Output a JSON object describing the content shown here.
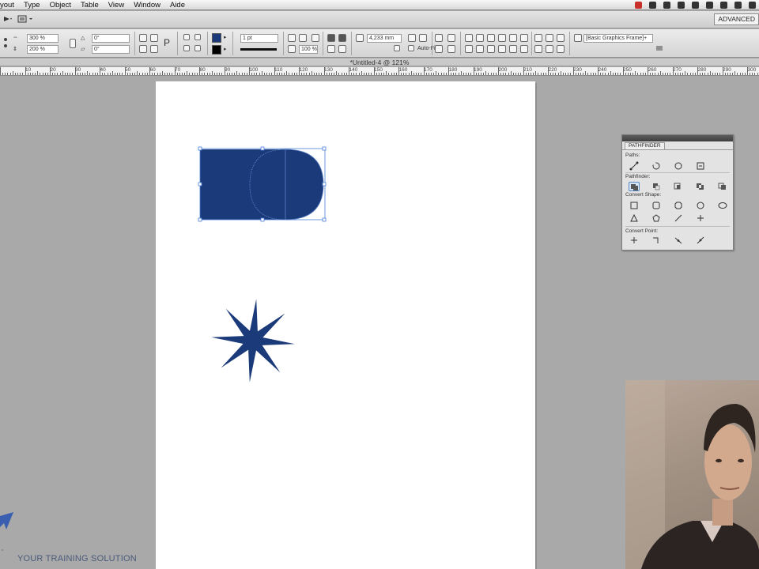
{
  "menubar": {
    "items": [
      "yout",
      "Type",
      "Object",
      "Table",
      "View",
      "Window",
      "Aide"
    ]
  },
  "appbar": {
    "workspace_label": "ADVANCED"
  },
  "control": {
    "x_value": "300 %",
    "y_value": "200 %",
    "w_value": "0°",
    "h_value": "0°",
    "stroke_value": "1 pt",
    "opacity_value": "100 %",
    "size_value": "4,233 mm",
    "autofit_label": "Auto-Fit",
    "style_value": "[Basic Graphics Frame]+",
    "fill_color": "#1b3a7a",
    "stroke_color": "#000000"
  },
  "document": {
    "tab_title": "*Untitled-4 @ 121%"
  },
  "ruler": {
    "labels": [
      "10",
      "20",
      "30",
      "40",
      "50",
      "60",
      "70",
      "80",
      "90",
      "100",
      "110",
      "120",
      "130",
      "140",
      "150",
      "160",
      "170",
      "180",
      "190",
      "200",
      "210",
      "220",
      "230",
      "240",
      "250",
      "260",
      "270",
      "280",
      "290",
      "300"
    ]
  },
  "canvas": {
    "shape_color": "#1b3a7a",
    "selection_color": "#4a7fd4"
  },
  "pathfinder": {
    "tab_label": "PATHFINDER",
    "sections": {
      "paths": "Paths:",
      "pathfinder": "Pathfinder:",
      "convert_shape": "Convert Shape:",
      "convert_point": "Convert Point:"
    }
  },
  "branding": {
    "slogan": "YOUR TRAINING SOLUTION",
    "accent": "#3a5fb0"
  }
}
